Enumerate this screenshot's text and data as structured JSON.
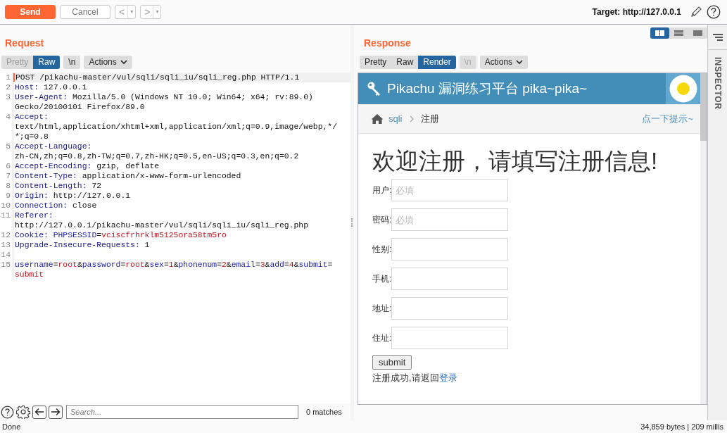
{
  "toolbar": {
    "send": "Send",
    "cancel": "Cancel",
    "back": "<",
    "back_menu": "▾",
    "forward": ">",
    "forward_menu": "▾",
    "target": "Target: http://127.0.0.1"
  },
  "request": {
    "title": "Request",
    "tabs": [
      {
        "label": "Pretty",
        "selected": false,
        "disabled": true
      },
      {
        "label": "Raw",
        "selected": true,
        "disabled": false
      }
    ],
    "newline_toggle": {
      "label": "\\n",
      "disabled": false
    },
    "actions": "Actions",
    "lines": [
      {
        "number": "1",
        "rows": [
          [
            {
              "kind": "text",
              "text": "POST /pikachu-master/vul/sqli/sqli_iu/sqli_reg.php HTTP/1.1"
            }
          ]
        ]
      },
      {
        "number": "2",
        "rows": [
          [
            {
              "kind": "name",
              "text": "Host:"
            },
            {
              "kind": "text",
              "text": " 127.0.0.1"
            }
          ]
        ]
      },
      {
        "number": "3",
        "rows": [
          [
            {
              "kind": "name",
              "text": "User-Agent:"
            },
            {
              "kind": "text",
              "text": " Mozilla/5.0 (Windows NT 10.0; Win64; x64; rv:89.0)"
            }
          ],
          [
            {
              "kind": "text",
              "text": "Gecko/20100101 Firefox/89.0"
            }
          ]
        ]
      },
      {
        "number": "4",
        "rows": [
          [
            {
              "kind": "name",
              "text": "Accept:"
            }
          ],
          [
            {
              "kind": "text",
              "text": "text/html,application/xhtml+xml,application/xml;q=0.9,image/webp,*/"
            }
          ],
          [
            {
              "kind": "text",
              "text": "*;q=0.8"
            }
          ]
        ]
      },
      {
        "number": "5",
        "rows": [
          [
            {
              "kind": "name",
              "text": "Accept-Language:"
            }
          ],
          [
            {
              "kind": "text",
              "text": "zh-CN,zh;q=0.8,zh-TW;q=0.7,zh-HK;q=0.5,en-US;q=0.3,en;q=0.2"
            }
          ]
        ]
      },
      {
        "number": "6",
        "rows": [
          [
            {
              "kind": "name",
              "text": "Accept-Encoding:"
            },
            {
              "kind": "text",
              "text": " gzip, deflate"
            }
          ]
        ]
      },
      {
        "number": "7",
        "rows": [
          [
            {
              "kind": "name",
              "text": "Content-Type:"
            },
            {
              "kind": "text",
              "text": " application/x-www-form-urlencoded"
            }
          ]
        ]
      },
      {
        "number": "8",
        "rows": [
          [
            {
              "kind": "name",
              "text": "Content-Length:"
            },
            {
              "kind": "text",
              "text": " 72"
            }
          ]
        ]
      },
      {
        "number": "9",
        "rows": [
          [
            {
              "kind": "name",
              "text": "Origin:"
            },
            {
              "kind": "text",
              "text": " http://127.0.0.1"
            }
          ]
        ]
      },
      {
        "number": "10",
        "rows": [
          [
            {
              "kind": "name",
              "text": "Connection:"
            },
            {
              "kind": "text",
              "text": " close"
            }
          ]
        ]
      },
      {
        "number": "11",
        "rows": [
          [
            {
              "kind": "name",
              "text": "Referer:"
            }
          ],
          [
            {
              "kind": "text",
              "text": "http://127.0.0.1/pikachu-master/vul/sqli/sqli_iu/sqli_reg.php"
            }
          ]
        ]
      },
      {
        "number": "12",
        "rows": [
          [
            {
              "kind": "name",
              "text": "Cookie:"
            },
            {
              "kind": "text",
              "text": " "
            },
            {
              "kind": "param",
              "text": "PHPSESSID"
            },
            {
              "kind": "text",
              "text": "="
            },
            {
              "kind": "value",
              "text": "vciscfrhrklm5125ora58tm5ro"
            }
          ]
        ]
      },
      {
        "number": "13",
        "rows": [
          [
            {
              "kind": "name",
              "text": "Upgrade-Insecure-Requests:"
            },
            {
              "kind": "text",
              "text": " 1"
            }
          ]
        ]
      },
      {
        "number": "14",
        "rows": [
          []
        ]
      },
      {
        "number": "15",
        "rows": [
          [
            {
              "kind": "param",
              "text": "username"
            },
            {
              "kind": "text",
              "text": "="
            },
            {
              "kind": "value",
              "text": "root"
            },
            {
              "kind": "text",
              "text": "&"
            },
            {
              "kind": "param",
              "text": "password"
            },
            {
              "kind": "text",
              "text": "="
            },
            {
              "kind": "value",
              "text": "root"
            },
            {
              "kind": "text",
              "text": "&"
            },
            {
              "kind": "param",
              "text": "sex"
            },
            {
              "kind": "text",
              "text": "="
            },
            {
              "kind": "value",
              "text": "1"
            },
            {
              "kind": "text",
              "text": "&"
            },
            {
              "kind": "param",
              "text": "phonenum"
            },
            {
              "kind": "text",
              "text": "="
            },
            {
              "kind": "value",
              "text": "2"
            },
            {
              "kind": "text",
              "text": "&"
            },
            {
              "kind": "param",
              "text": "email"
            },
            {
              "kind": "text",
              "text": "="
            },
            {
              "kind": "value",
              "text": "3"
            },
            {
              "kind": "text",
              "text": "&"
            },
            {
              "kind": "param",
              "text": "add"
            },
            {
              "kind": "text",
              "text": "="
            },
            {
              "kind": "value",
              "text": "4"
            },
            {
              "kind": "text",
              "text": "&"
            },
            {
              "kind": "param",
              "text": "submit"
            },
            {
              "kind": "text",
              "text": "="
            }
          ],
          [
            {
              "kind": "value",
              "text": "submit"
            }
          ]
        ]
      }
    ],
    "search": {
      "placeholder": "Search...",
      "matches": "0 matches"
    }
  },
  "layout_toggles": [
    {
      "kind": "columns",
      "selected": true
    },
    {
      "kind": "rows",
      "selected": false
    },
    {
      "kind": "single",
      "selected": false
    }
  ],
  "response": {
    "title": "Response",
    "tabs": [
      {
        "label": "Pretty",
        "selected": false,
        "disabled": false
      },
      {
        "label": "Raw",
        "selected": false,
        "disabled": false
      },
      {
        "label": "Render",
        "selected": true,
        "disabled": false
      }
    ],
    "newline_toggle": {
      "label": "\\n",
      "disabled": true
    },
    "actions": "Actions",
    "page": {
      "site_title": "Pikachu 漏洞练习平台 pika~pika~",
      "breadcrumb": [
        {
          "label": "sqli",
          "link": true
        },
        {
          "label": "注册",
          "link": false
        }
      ],
      "hint": "点一下提示~",
      "heading": "欢迎注册，请填写注册信息!",
      "fields": [
        {
          "label": "用户:",
          "placeholder": "必填"
        },
        {
          "label": "密码:",
          "placeholder": "必填"
        },
        {
          "label": "性别:"
        },
        {
          "label": "手机:"
        },
        {
          "label": "地址:"
        },
        {
          "label": "住址:"
        }
      ],
      "submit": "submit",
      "message": "注册成功,请返回",
      "message_link": "登录"
    }
  },
  "inspector": {
    "label": "INSPECTOR"
  },
  "status_bar": {
    "left": "Done",
    "right": "34,859 bytes | 209 millis"
  }
}
